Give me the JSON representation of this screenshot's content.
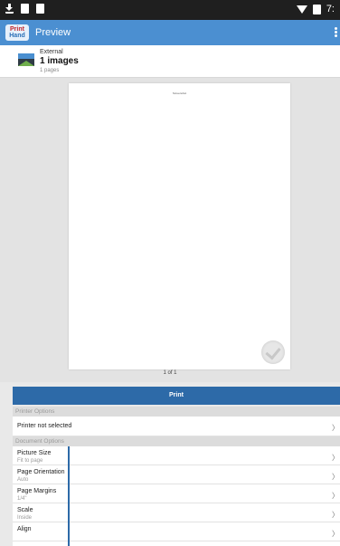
{
  "status_bar": {
    "icons_left": [
      "download-icon",
      "image-icon",
      "image-icon"
    ],
    "icons_right": [
      "wifi-icon",
      "battery-icon"
    ],
    "time": "7:"
  },
  "app_bar": {
    "logo_line1": "Print",
    "logo_line2": "Hand",
    "title": "Preview"
  },
  "document": {
    "source": "External",
    "count": "1 images",
    "pages": "1 pages"
  },
  "preview": {
    "header_text": "Screenshot",
    "page_indicator": "1 of 1"
  },
  "print_button": "Print",
  "printer_options": {
    "header": "Printer Options",
    "printer": "Printer not selected"
  },
  "document_options": {
    "header": "Document Options",
    "rows": [
      {
        "label": "Picture Size",
        "value": "Fit to page"
      },
      {
        "label": "Page Orientation",
        "value": "Auto"
      },
      {
        "label": "Page Margins",
        "value": "1/4\""
      },
      {
        "label": "Scale",
        "value": "Inside"
      },
      {
        "label": "Align",
        "value": ""
      }
    ]
  },
  "colors": {
    "app_bar": "#4b8fd1",
    "print_button": "#2d6aa8",
    "status_bar": "#1f1f1f"
  }
}
